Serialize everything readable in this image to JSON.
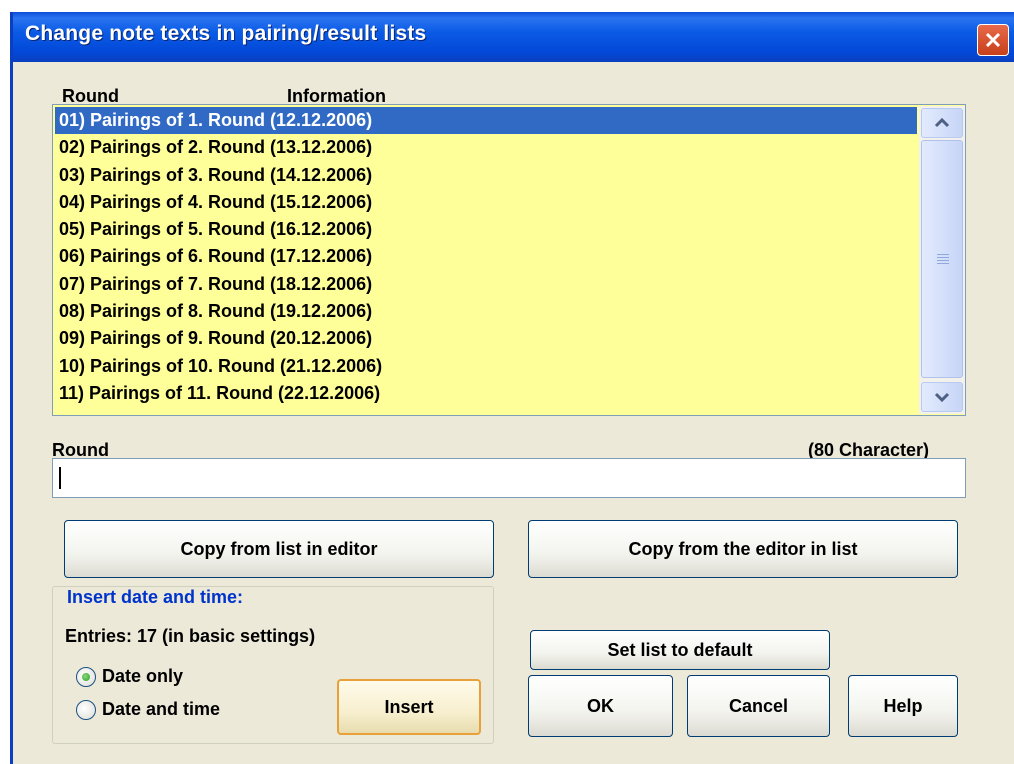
{
  "dialog": {
    "title": "Change note texts in pairing/result lists"
  },
  "list": {
    "header_round": "Round",
    "header_info": "Information",
    "items": [
      "01) Pairings of 1. Round (12.12.2006)",
      "02) Pairings of 2. Round (13.12.2006)",
      "03) Pairings of 3. Round (14.12.2006)",
      "04) Pairings of 4. Round (15.12.2006)",
      "05) Pairings of 5. Round (16.12.2006)",
      "06) Pairings of 6. Round (17.12.2006)",
      "07) Pairings of 7. Round (18.12.2006)",
      "08) Pairings of 8. Round (19.12.2006)",
      "09) Pairings of 9. Round (20.12.2006)",
      "10) Pairings of 10. Round (21.12.2006)",
      "11) Pairings of 11. Round (22.12.2006)"
    ],
    "selected_index": 0,
    "background": "#ffff99",
    "selection_color": "#316ac5"
  },
  "editor": {
    "label": "Round",
    "limit": "(80 Character)",
    "value": ""
  },
  "buttons": {
    "copy_to_editor": "Copy from list in editor",
    "copy_to_list": "Copy from the editor in list",
    "set_default": "Set list to default",
    "ok": "OK",
    "cancel": "Cancel",
    "help": "Help"
  },
  "insert_group": {
    "title": "Insert date and time:",
    "entries": "Entries: 17 (in basic settings)",
    "option_date": "Date only",
    "option_datetime": "Date and time",
    "selected_option": "Date only",
    "insert_button": "Insert"
  },
  "icons": {
    "close": "close-icon",
    "scroll_up": "chevron-up-icon",
    "scroll_down": "chevron-down-icon"
  }
}
